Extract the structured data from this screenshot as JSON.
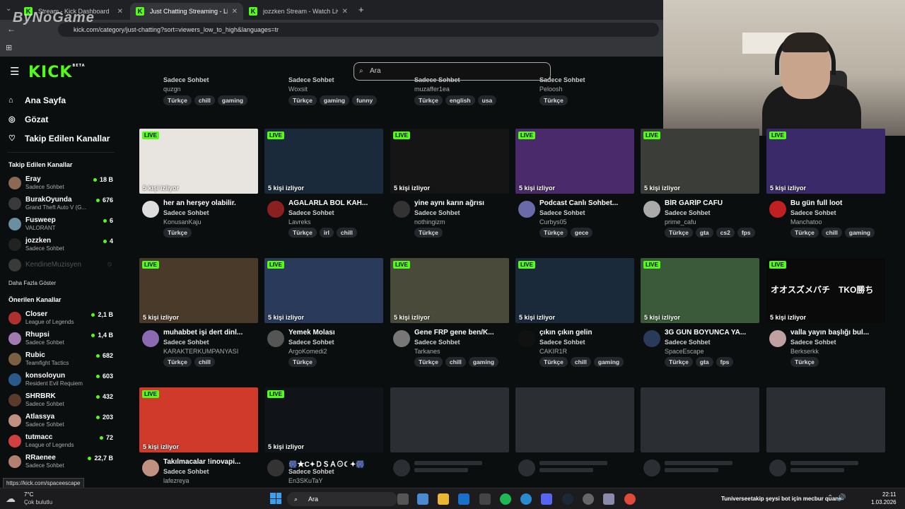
{
  "browser": {
    "tabs": [
      {
        "title": "Stream - Kick Dashboard",
        "active": false
      },
      {
        "title": "Just Chatting Streaming - Live S",
        "active": true
      },
      {
        "title": "jozzken Stream - Watch Live on",
        "active": false
      }
    ],
    "url": "kick.com/category/just-chatting?sort=viewers_low_to_high&languages=tr",
    "watermark": "ByNoGame",
    "status_link": "https://kick.com/spaceescape"
  },
  "header": {
    "logo": "KICK",
    "logo_sup": "BETA",
    "search_placeholder": "Ara"
  },
  "sidebar": {
    "nav": [
      {
        "label": "Ana Sayfa",
        "icon": "home-icon"
      },
      {
        "label": "Gözat",
        "icon": "compass-icon"
      },
      {
        "label": "Takip Edilen Kanallar",
        "icon": "heart-icon"
      }
    ],
    "followed_title": "Takip Edilen Kanallar",
    "followed": [
      {
        "name": "Eray",
        "category": "Sadece Sohbet",
        "viewers": "18 B",
        "color": "#8a6a55"
      },
      {
        "name": "BurakOyunda",
        "category": "Grand Theft Auto V (G...",
        "viewers": "676",
        "color": "#3a3a3a"
      },
      {
        "name": "Fusweep",
        "category": "VALORANT",
        "viewers": "6",
        "color": "#6a8fa0"
      },
      {
        "name": "jozzken",
        "category": "Sadece Sohbet",
        "viewers": "4",
        "color": "#222"
      }
    ],
    "offline": {
      "name": "KendineMuzisyen"
    },
    "show_more": "Daha Fazla Göster",
    "recommended_title": "Önerilen Kanallar",
    "recommended": [
      {
        "name": "Closer",
        "category": "League of Legends",
        "viewers": "2,1 B",
        "color": "#b03030"
      },
      {
        "name": "Rhupsi",
        "category": "Sadece Sohbet",
        "viewers": "1,4 B",
        "color": "#a07ab0"
      },
      {
        "name": "Rubic",
        "category": "Teamfight Tactics",
        "viewers": "682",
        "color": "#7a6040"
      },
      {
        "name": "konsoloyun",
        "category": "Resident Evil Requiem",
        "viewers": "603",
        "color": "#2a5a8a"
      },
      {
        "name": "SHRBRK",
        "category": "Sadece Sohbet",
        "viewers": "432",
        "color": "#5a3a2a"
      },
      {
        "name": "Atlassya",
        "category": "Sadece Sohbet",
        "viewers": "203",
        "color": "#c09080"
      },
      {
        "name": "tutmacc",
        "category": "League of Legends",
        "viewers": "72",
        "color": "#d04040"
      },
      {
        "name": "RRaenee",
        "category": "Sadece Sohbet",
        "viewers": "22,7 B",
        "color": "#b08070"
      }
    ]
  },
  "top_row": [
    {
      "category": "Sadece Sohbet",
      "user": "quzgn",
      "tags": [
        "Türkçe",
        "chill",
        "gaming"
      ]
    },
    {
      "category": "Sadece Sohbet",
      "user": "Woxsit",
      "tags": [
        "Türkçe",
        "gaming",
        "funny"
      ]
    },
    {
      "category": "Sadece Sohbet",
      "user": "muzaffer1ea",
      "tags": [
        "Türkçe",
        "english",
        "usa"
      ]
    },
    {
      "category": "Sadece Sohbet",
      "user": "Peloosh",
      "tags": [
        "Türkçe"
      ]
    }
  ],
  "live_label": "LIVE",
  "streams": [
    {
      "title": "her an herşey olabilir.",
      "category": "Sadece Sohbet",
      "user": "KonusanKaju",
      "viewers": "5 kişi izliyor",
      "tags": [
        "Türkçe"
      ],
      "thumb": "#e8e4df",
      "ava": "#ddd"
    },
    {
      "title": "AGALARLA BOL KAH...",
      "category": "Sadece Sohbet",
      "user": "Lavreks",
      "viewers": "5 kişi izliyor",
      "tags": [
        "Türkçe",
        "irl",
        "chill"
      ],
      "thumb": "#1a2a3a",
      "ava": "#8a2020"
    },
    {
      "title": "yine aynı karın ağrısı",
      "category": "Sadece Sohbet",
      "user": "nothingizm",
      "viewers": "5 kişi izliyor",
      "tags": [
        "Türkçe"
      ],
      "thumb": "#151515",
      "ava": "#333"
    },
    {
      "title": "Podcast Canlı Sohbet...",
      "category": "Sadece Sohbet",
      "user": "Curbys05",
      "viewers": "5 kişi izliyor",
      "tags": [
        "Türkçe",
        "gece"
      ],
      "thumb": "#4a2a6a",
      "ava": "#6a6aaa"
    },
    {
      "title": "BİR GARİP CAFU",
      "category": "Sadece Sohbet",
      "user": "prime_cafu",
      "viewers": "5 kişi izliyor",
      "tags": [
        "Türkçe",
        "gta",
        "cs2",
        "fps"
      ],
      "thumb": "#3a3d38",
      "ava": "#aaa"
    },
    {
      "title": "Bu gün full loot",
      "category": "Sadece Sohbet",
      "user": "Manchatoo",
      "viewers": "5 kişi izliyor",
      "tags": [
        "Türkçe",
        "chill",
        "gaming"
      ],
      "thumb": "#3a2a6a",
      "ava": "#c02020"
    },
    {
      "title": "muhabbet işi dert dinl...",
      "category": "Sadece Sohbet",
      "user": "KARAKTERKUMPANYASI",
      "viewers": "5 kişi izliyor",
      "tags": [
        "Türkçe",
        "chill"
      ],
      "thumb": "#4a3a2a",
      "ava": "#8a6ab0"
    },
    {
      "title": "Yemek Molası",
      "category": "Sadece Sohbet",
      "user": "ArgoKomedi2",
      "viewers": "5 kişi izliyor",
      "tags": [
        "Türkçe"
      ],
      "thumb": "#2a3a5a",
      "ava": "#555"
    },
    {
      "title": "Gene FRP gene ben/K...",
      "category": "Sadece Sohbet",
      "user": "Tarkanes",
      "viewers": "5 kişi izliyor",
      "tags": [
        "Türkçe",
        "chill",
        "gaming"
      ],
      "thumb": "#4a4a3a",
      "ava": "#777"
    },
    {
      "title": "çıkın çıkın gelin",
      "category": "Sadece Sohbet",
      "user": "CAKIR1R",
      "viewers": "5 kişi izliyor",
      "tags": [
        "Türkçe",
        "chill",
        "gaming"
      ],
      "thumb": "#1a2a3a",
      "ava": "#111"
    },
    {
      "title": "3G GÜN BOYUNCA YA...",
      "category": "Sadece Sohbet",
      "user": "SpaceEscape",
      "viewers": "5 kişi izliyor",
      "tags": [
        "Türkçe",
        "gta",
        "fps"
      ],
      "thumb": "#3a5a3a",
      "ava": "#2a3a5a"
    },
    {
      "title": "valla yayın başlığı bul...",
      "category": "Sadece Sohbet",
      "user": "Berkserkk",
      "viewers": "5 kişi izliyor",
      "tags": [
        "Türkçe"
      ],
      "thumb": "#0a0a0a",
      "ava": "#c0a0a0",
      "overlay": "オオスズメバチ　TKO勝ち"
    },
    {
      "title": "Takılmacalar !inovapi...",
      "category": "Sadece Sohbet",
      "user": "lafezreya",
      "viewers": "5 kişi izliyor",
      "tags": [],
      "thumb": "#d03a2a",
      "ava": "#c09080"
    },
    {
      "title": "🎆★C✦ＤＳＡ⊙☾✦🎆",
      "category": "Sadece Sohbet",
      "user": "En3SKuTaY",
      "viewers": "5 kişi izliyor",
      "tags": [],
      "thumb": "#101418",
      "ava": "#333"
    }
  ],
  "taskbar": {
    "weather_temp": "7°C",
    "weather_desc": "Çok bulutlu",
    "search": "Ara",
    "ticker_name": "Tuniversee",
    "ticker_text": "takip şeysi bot için mecbur quan",
    "time": "22:11",
    "date": "1.03.2026"
  }
}
